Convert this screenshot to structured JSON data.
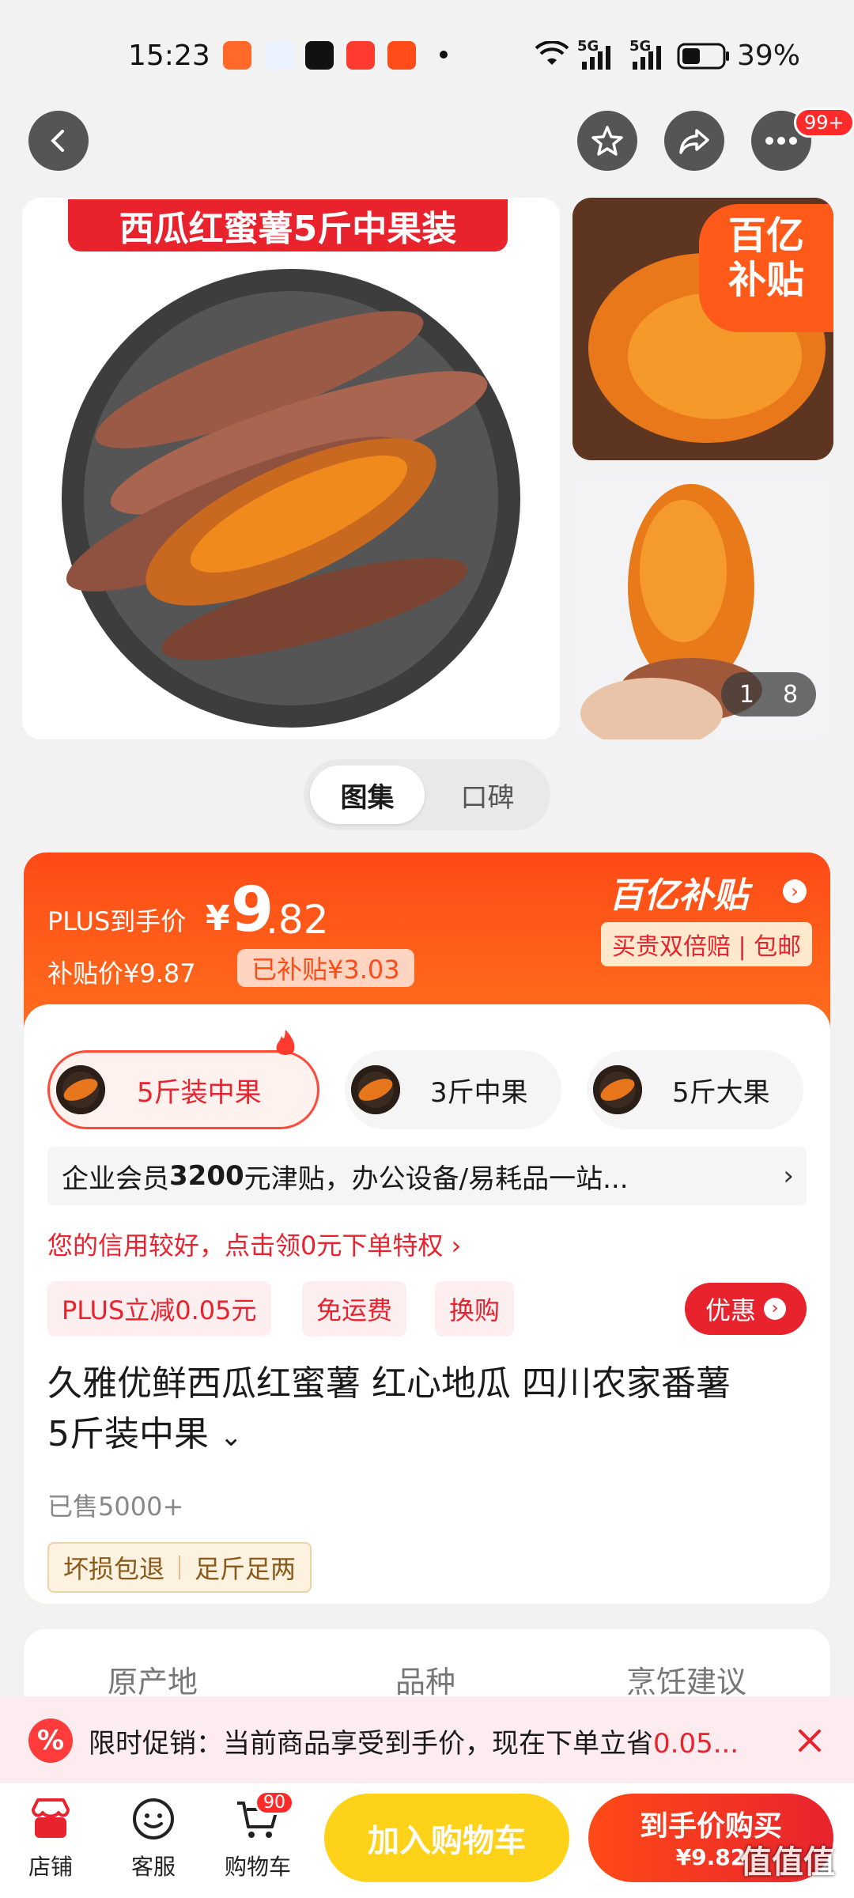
{
  "status": {
    "time": "15:23",
    "battery": "39%",
    "network1": "5G",
    "network2": "5G"
  },
  "nav": {
    "more_badge": "99+"
  },
  "gallery": {
    "main_banner": "西瓜红蜜薯5斤中果装",
    "subsidy_badge_line1": "百亿",
    "subsidy_badge_line2": "补贴",
    "page_current": "1",
    "page_total": "8"
  },
  "toggle": {
    "tab1": "图集",
    "tab2": "口碑"
  },
  "price": {
    "plus_label": "PLUS到手价",
    "currency": "¥",
    "int": "9",
    "dec": ".82",
    "subsidy_price": "补贴价¥9.87",
    "subsidized": "已补贴¥3.03",
    "brand": "百亿补贴",
    "guarantee": "买贵双倍赔 | 包邮"
  },
  "specs": [
    {
      "label": "5斤装中果"
    },
    {
      "label": "3斤中果"
    },
    {
      "label": "5斤大果"
    }
  ],
  "enterprise": {
    "prefix": "企业会员",
    "amount": "3200",
    "suffix": "元津贴，办公设备/易耗品一站...",
    "arrow": "›"
  },
  "credit": "您的信用较好，点击领0元下单特权 ›",
  "chips": [
    "PLUS立减0.05元",
    "免运费",
    "换购"
  ],
  "discount_btn": "优惠",
  "title": {
    "line1": "久雅优鲜西瓜红蜜薯 红心地瓜 四川农家番薯",
    "line2": "5斤装中果"
  },
  "sold": "已售5000+",
  "tags": [
    "坏损包退",
    "足斤足两"
  ],
  "attrs": [
    "原产地",
    "品种",
    "烹饪建议"
  ],
  "promo": {
    "text": "限时促销：当前商品享受到手价，现在下单立省",
    "amount": "0.05..."
  },
  "bottom": {
    "shop": "店铺",
    "service": "客服",
    "cart": "购物车",
    "cart_badge": "90",
    "add_cart": "加入购物车",
    "buy": "到手价购买",
    "buy_price": "¥9.82",
    "watermark": "值值值"
  },
  "colors": {
    "brand_orange": "#ff5a1a",
    "brand_red": "#e8232e",
    "cart_yellow": "#ffd21a"
  }
}
